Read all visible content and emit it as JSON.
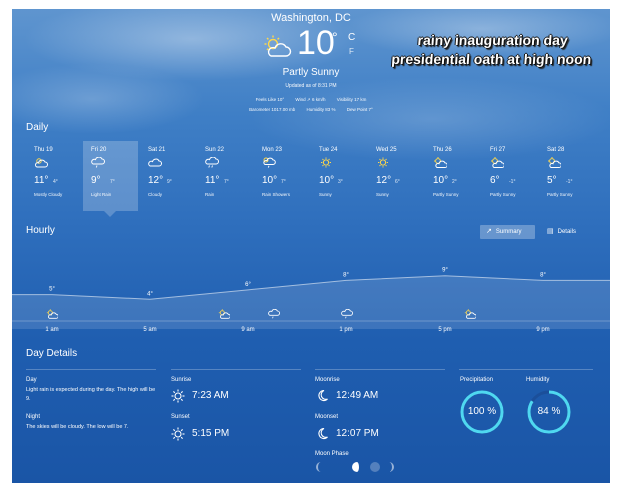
{
  "header": {
    "location": "Washington, DC",
    "current_temp": "10",
    "degree": "°",
    "unit_c": "C",
    "unit_f": "F",
    "condition": "Partly Sunny",
    "current_icon": "partly-sunny-icon",
    "updated": "Updated as of 8:31 PM",
    "stats_line1": [
      "Feels Like 10°",
      "Wind ↗ 6 km/h",
      "Visibility 17 km"
    ],
    "stats_line2": [
      "Barometer 1017.00 mb",
      "Humidity 83 %",
      "Dew Point 7°"
    ]
  },
  "overlay_caption": {
    "line1": "rainy inauguration day",
    "line2": "presidential oath at high noon"
  },
  "daily": {
    "title": "Daily",
    "days": [
      {
        "name": "Thu 19",
        "hi": "11°",
        "lo": "4°",
        "cond": "Mostly Cloudy",
        "icon": "partly-cloudy-icon"
      },
      {
        "name": "Fri 20",
        "hi": "9°",
        "lo": "7°",
        "cond": "Light Rain",
        "icon": "light-rain-icon"
      },
      {
        "name": "Sat 21",
        "hi": "12°",
        "lo": "9°",
        "cond": "Cloudy",
        "icon": "cloudy-icon"
      },
      {
        "name": "Sun 22",
        "hi": "11°",
        "lo": "7°",
        "cond": "Rain",
        "icon": "rain-icon"
      },
      {
        "name": "Mon 23",
        "hi": "10°",
        "lo": "7°",
        "cond": "Rain Showers",
        "icon": "rain-showers-icon"
      },
      {
        "name": "Tue 24",
        "hi": "10°",
        "lo": "3°",
        "cond": "Sunny",
        "icon": "sunny-icon"
      },
      {
        "name": "Wed 25",
        "hi": "12°",
        "lo": "6°",
        "cond": "Sunny",
        "icon": "sunny-icon"
      },
      {
        "name": "Thu 26",
        "hi": "10°",
        "lo": "2°",
        "cond": "Partly Sunny",
        "icon": "partly-sunny-icon"
      },
      {
        "name": "Fri 27",
        "hi": "6°",
        "lo": "-1°",
        "cond": "Partly Sunny",
        "icon": "partly-sunny-icon"
      },
      {
        "name": "Sat 28",
        "hi": "5°",
        "lo": "-1°",
        "cond": "Partly Sunny",
        "icon": "partly-sunny-icon"
      }
    ],
    "selected_index": 1
  },
  "hourly": {
    "title": "Hourly",
    "summary_label": "Summary",
    "details_label": "Details",
    "temps": [
      {
        "time": "1 am",
        "temp": "5°"
      },
      {
        "time": "5 am",
        "temp": "4°"
      },
      {
        "time": "9 am",
        "temp": "6°"
      },
      {
        "time": "1 pm",
        "temp": "8°"
      },
      {
        "time": "5 pm",
        "temp": "9°"
      },
      {
        "time": "9 pm",
        "temp": "8°"
      }
    ],
    "time_labels": [
      "1 am",
      "5 am",
      "9 am",
      "1 pm",
      "5 pm",
      "9 pm"
    ]
  },
  "day_details": {
    "title": "Day Details",
    "day_label": "Day",
    "day_text": "Light rain is expected during the day. The high will be 9.",
    "night_label": "Night",
    "night_text": "The skies will be cloudy. The low will be 7.",
    "sunrise_label": "Sunrise",
    "sunrise": "7:23 AM",
    "sunset_label": "Sunset",
    "sunset": "5:15 PM",
    "moonrise_label": "Moonrise",
    "moonrise": "12:49 AM",
    "moonset_label": "Moonset",
    "moonset": "12:07 PM",
    "moon_phase_label": "Moon Phase",
    "precipitation_label": "Precipitation",
    "precipitation": "100 %",
    "precipitation_value": 100,
    "humidity_label": "Humidity",
    "humidity": "84 %",
    "humidity_value": 84
  },
  "colors": {
    "ring": "#4fd8f0",
    "ring_track": "#1b4f9a"
  }
}
